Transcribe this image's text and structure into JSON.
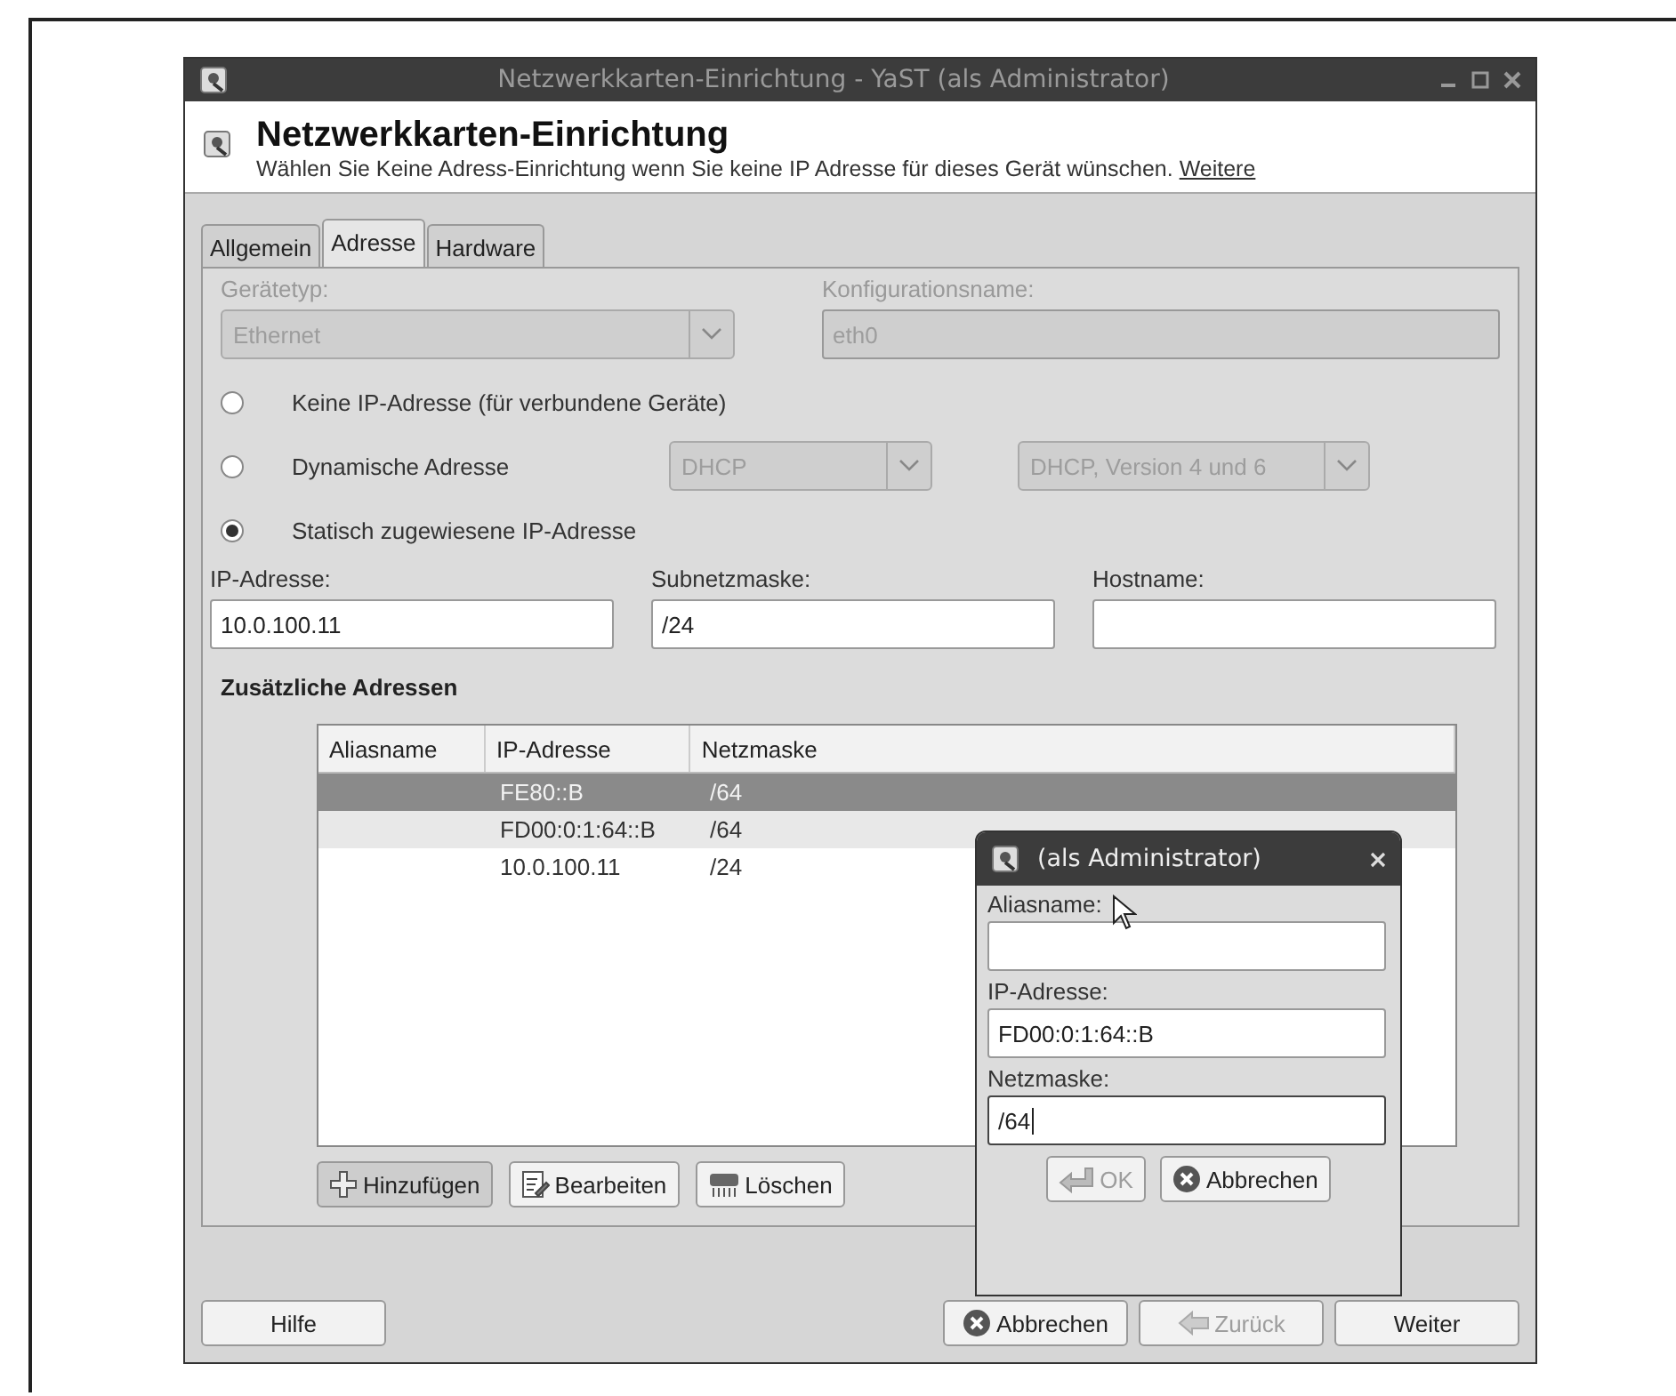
{
  "window": {
    "title": "Netzwerkkarten-Einrichtung - YaST (als Administrator)"
  },
  "header": {
    "title": "Netzwerkkarten-Einrichtung",
    "description": "Wählen Sie Keine Adress-Einrichtung wenn Sie keine IP Adresse für dieses Gerät wünschen.",
    "link": "Weitere"
  },
  "tabs": [
    {
      "label": "Allgemein",
      "selected": false
    },
    {
      "label": "Adresse",
      "selected": true
    },
    {
      "label": "Hardware",
      "selected": false
    }
  ],
  "device": [
    {
      "label": "Gerätetyp:",
      "value": "Ethernet",
      "kind": "combo",
      "disabled": true
    },
    {
      "label": "Konfigurationsname:",
      "value": "eth0",
      "kind": "text",
      "disabled": true
    }
  ],
  "address_modes": [
    {
      "label": "Keine IP-Adresse (für verbundene Geräte)",
      "selected": false
    },
    {
      "label": "Dynamische Adresse",
      "selected": false,
      "combos": [
        {
          "value": "DHCP",
          "disabled": true
        },
        {
          "value": "DHCP, Version 4 und 6",
          "disabled": true
        }
      ]
    },
    {
      "label": "Statisch zugewiesene IP-Adresse",
      "selected": true
    }
  ],
  "static_fields": [
    {
      "label": "IP-Adresse:",
      "value": "10.0.100.11"
    },
    {
      "label": "Subnetzmaske:",
      "value": "/24"
    },
    {
      "label": "Hostname:"
    }
  ],
  "additional": {
    "title": "Zusätzliche Adressen",
    "columns": [
      "Aliasname",
      "IP-Adresse",
      "Netzmaske"
    ],
    "rows": [
      {
        "cells": [
          "",
          "FE80::B",
          "/64"
        ],
        "selected": true
      },
      {
        "cells": [
          "",
          "FD00:0:1:64::B",
          "/64"
        ],
        "selected": false
      },
      {
        "cells": [
          "",
          "10.0.100.11",
          "/24"
        ],
        "selected": false
      }
    ],
    "buttons": [
      {
        "label": "Hinzufügen",
        "kind": "plus"
      },
      {
        "label": "Bearbeiten",
        "kind": "edit"
      },
      {
        "label": "Löschen",
        "kind": "delete"
      }
    ]
  },
  "footer": [
    {
      "label": "Hilfe",
      "disabled": false
    },
    {
      "label": "Abbrechen",
      "kind": "cancel",
      "disabled": false
    },
    {
      "label": "Zurück",
      "kind": "back",
      "disabled": true
    },
    {
      "label": "Weiter",
      "disabled": false
    }
  ],
  "dialog": {
    "title": "(als Administrator)",
    "fields": [
      {
        "label": "Aliasname:",
        "focused": false
      },
      {
        "label": "IP-Adresse:",
        "value": "FD00:0:1:64::B",
        "focused": false
      },
      {
        "label": "Netzmaske:",
        "value": "/64",
        "focused": true
      }
    ],
    "buttons": [
      {
        "label": "OK",
        "kind": "ok",
        "disabled": true
      },
      {
        "label": "Abbrechen",
        "kind": "cancel",
        "disabled": false
      }
    ]
  }
}
